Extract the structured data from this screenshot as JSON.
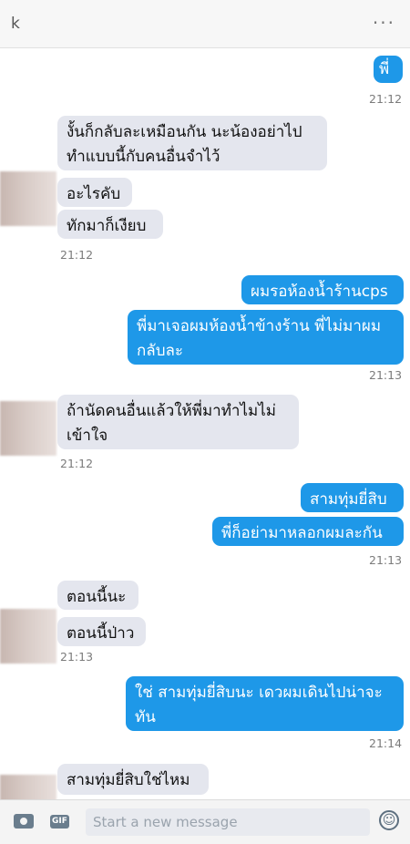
{
  "header": {
    "title": "k",
    "more_icon": "···"
  },
  "messages": [
    {
      "side": "out",
      "text": "พี่"
    },
    {
      "side": "time",
      "text": "21:12"
    },
    {
      "side": "in",
      "text": "งั้นก็กลับละเหมือนกัน นะน้องอย่าไปทำแบบนี้กับคนอื่นจำไว้"
    },
    {
      "side": "in",
      "text": "อะไรคับ"
    },
    {
      "side": "in",
      "text": "ทักมาก็เงียบ"
    },
    {
      "side": "time",
      "text": "21:12"
    },
    {
      "side": "out",
      "text": "ผมรอห้องน้ำร้านcps"
    },
    {
      "side": "out",
      "text": "พี่มาเจอผมห้องน้ำข้างร้าน พี่ไม่มาผมกลับละ"
    },
    {
      "side": "time",
      "text": "21:13"
    },
    {
      "side": "in",
      "text": "ถ้านัดคนอื่นแล้วให้พี่มาทำไมไม่เข้าใจ"
    },
    {
      "side": "time",
      "text": "21:12"
    },
    {
      "side": "out",
      "text": "สามทุ่มยี่สิบ"
    },
    {
      "side": "out",
      "text": "พี่ก็อย่ามาหลอกผมละกัน"
    },
    {
      "side": "time",
      "text": "21:13"
    },
    {
      "side": "in",
      "text": "ตอนนี้นะ"
    },
    {
      "side": "in",
      "text": "ตอนนี้ป่าว"
    },
    {
      "side": "time",
      "text": "21:13"
    },
    {
      "side": "out",
      "text": "ใช่ สามทุ่มยี่สิบนะ เดวผมเดินไปน่าจะทัน"
    },
    {
      "side": "time",
      "text": "21:14"
    },
    {
      "side": "in",
      "text": "สามทุ่มยี่สิบใช่ไหม"
    }
  ],
  "composer": {
    "placeholder": "Start a new message",
    "gif_label": "GIF",
    "emoji_glyph": "☺"
  },
  "icons": [
    "more-icon",
    "camera-icon",
    "gif-icon",
    "emoji-icon"
  ],
  "colors": {
    "outgoing": "#1e98e8",
    "incoming": "#e4e6ee",
    "header": "#f7f7f7"
  }
}
